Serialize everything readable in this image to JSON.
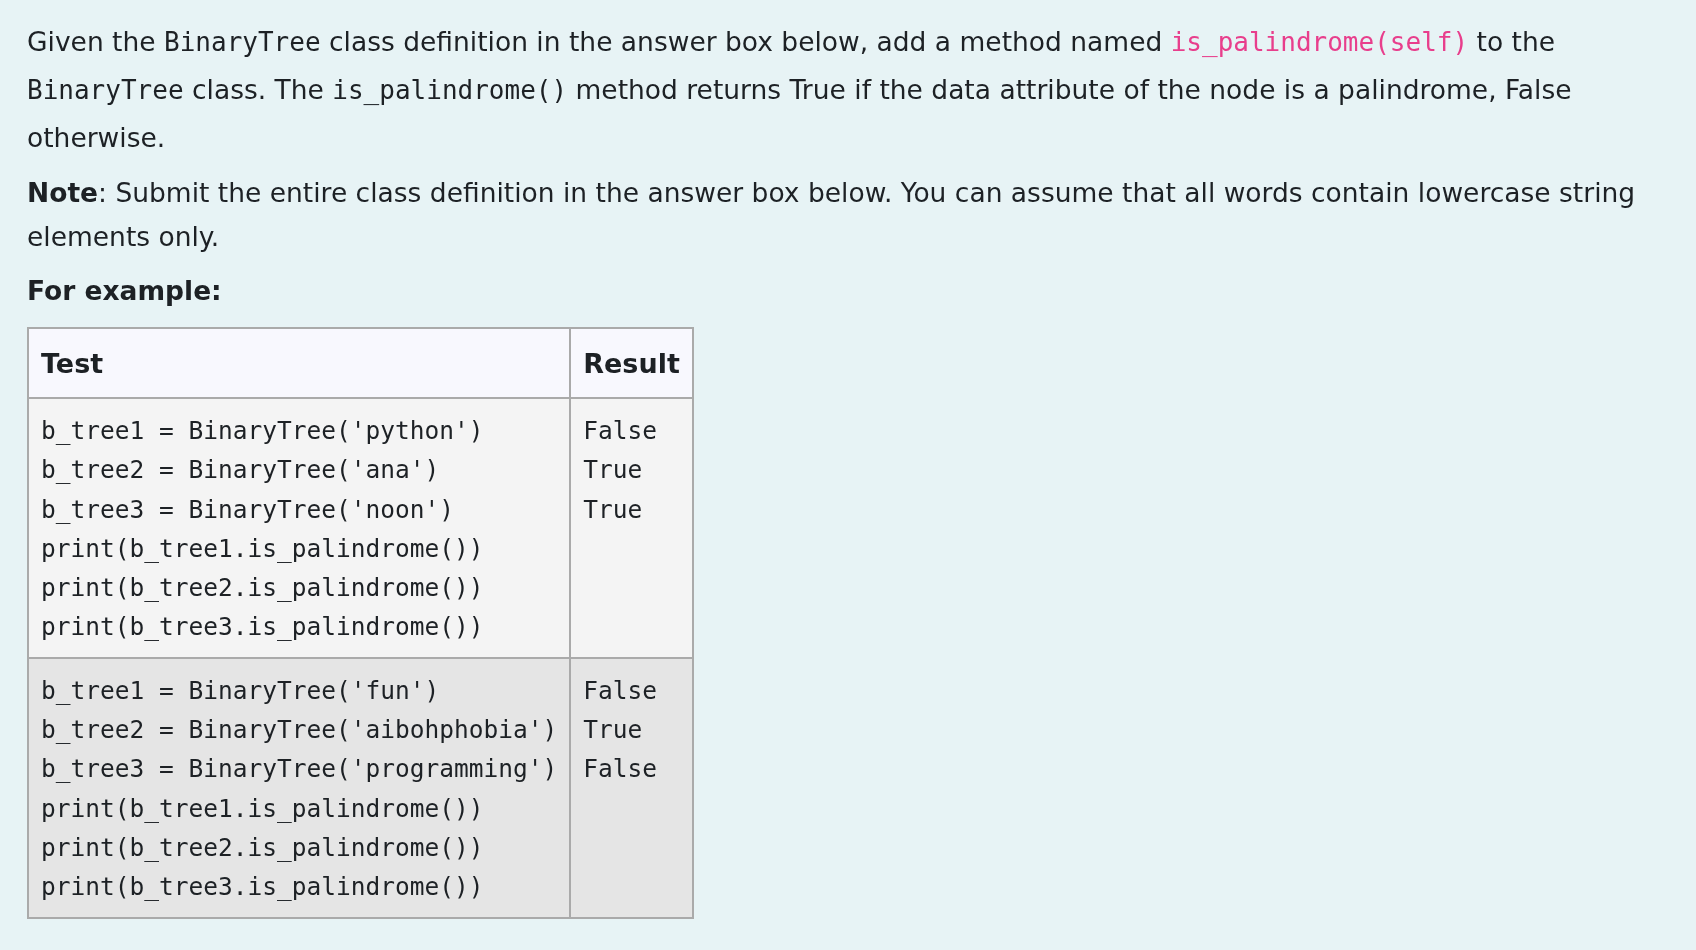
{
  "question": {
    "paragraphs": [
      {
        "parts": [
          {
            "kind": "text",
            "text": "Given the "
          },
          {
            "kind": "code",
            "text": "BinaryTree"
          },
          {
            "kind": "text",
            "text": " class definition in the answer box below, add a method named "
          },
          {
            "kind": "code_highlight",
            "text": "is_palindrome(self)"
          },
          {
            "kind": "text",
            "text": " to the "
          },
          {
            "kind": "code",
            "text": "BinaryTree"
          },
          {
            "kind": "text",
            "text": " class. The "
          },
          {
            "kind": "code",
            "text": "is_palindrome()"
          },
          {
            "kind": "text",
            "text": " method returns True if the data attribute of the node is a palindrome, False otherwise."
          }
        ]
      }
    ],
    "note": "**Note**: Submit the entire class definition in the answer box below. You can assume that all words contain lowercase string elements only.",
    "example_heading": "For example:"
  },
  "table": {
    "columns": [
      "Test",
      "Result"
    ],
    "rows": [
      {
        "test": "b_tree1 = BinaryTree('python')\nb_tree2 = BinaryTree('ana')\nb_tree3 = BinaryTree('noon')\nprint(b_tree1.is_palindrome())\nprint(b_tree2.is_palindrome())\nprint(b_tree3.is_palindrome())",
        "result": "False\nTrue\nTrue"
      },
      {
        "test": "b_tree1 = BinaryTree('fun')\nb_tree2 = BinaryTree('aibohphobia')\nb_tree3 = BinaryTree('programming')\nprint(b_tree1.is_palindrome())\nprint(b_tree2.is_palindrome())\nprint(b_tree3.is_palindrome())",
        "result": "False\nTrue\nFalse"
      }
    ]
  }
}
